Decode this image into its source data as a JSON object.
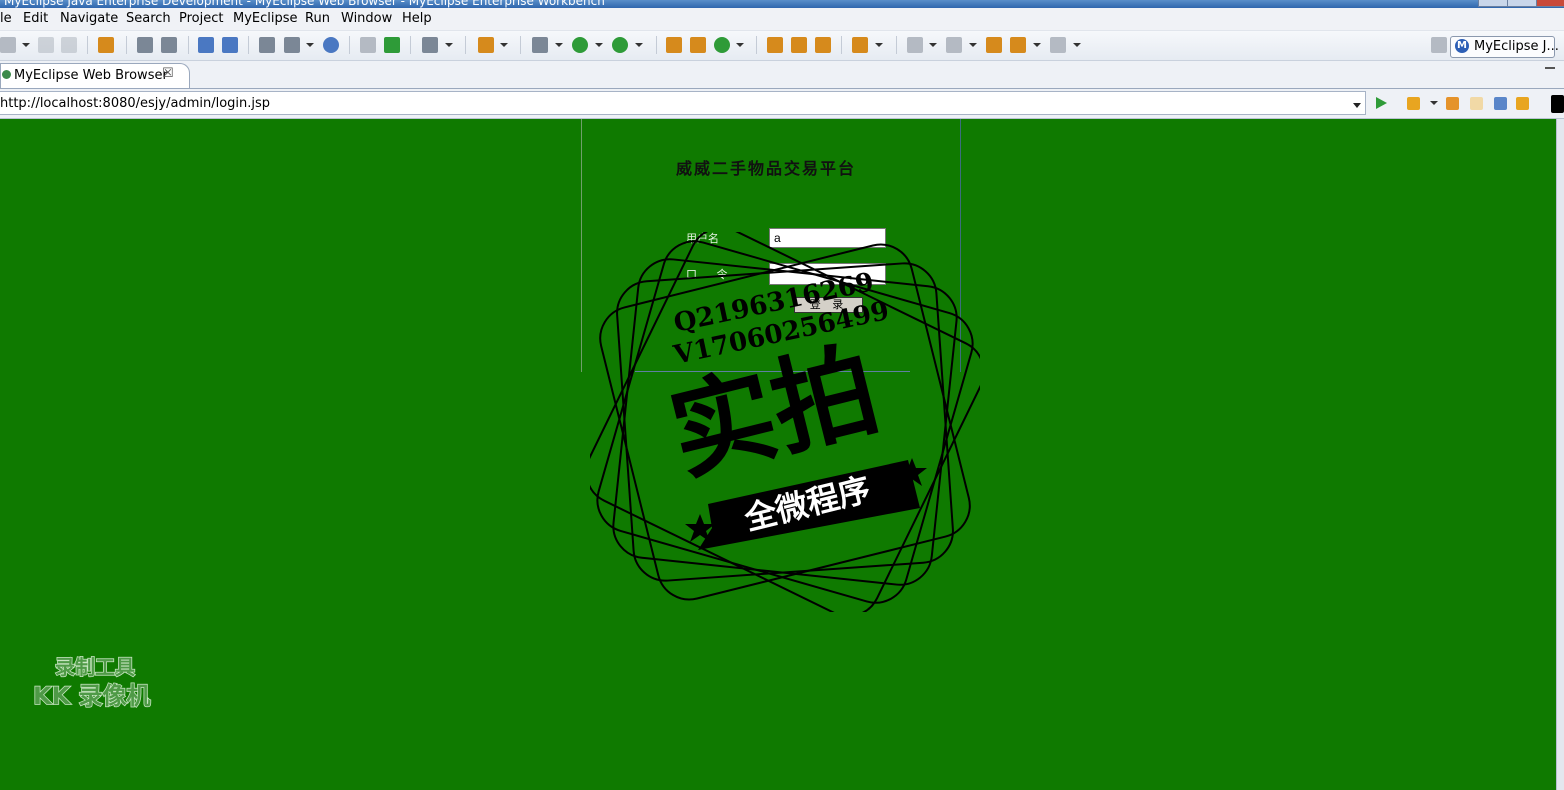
{
  "window": {
    "title": "MyEclipse Java Enterprise Development - MyEclipse Web Browser - MyEclipse Enterprise Workbench"
  },
  "menu": [
    "le",
    "Edit",
    "Navigate",
    "Search",
    "Project",
    "MyEclipse",
    "Run",
    "Window",
    "Help"
  ],
  "perspective": {
    "label": "MyEclipse J..."
  },
  "editor_tab": {
    "label": "MyEclipse Web Browser",
    "close": "☒"
  },
  "browser": {
    "url": "http://localhost:8080/esjy/admin/login.jsp"
  },
  "page": {
    "title": "威威二手物品交易平台",
    "username_label": "用户名",
    "password_label": "口 令",
    "username_value": "a",
    "password_value": "",
    "login_button": "登 录"
  },
  "watermark": {
    "qq": "Q2196316269",
    "wechat": "V17060256499",
    "big_text": "实拍",
    "ribbon_text": "全微程序"
  },
  "recorder": {
    "line1": "录制工具",
    "line2": "KK 录像机"
  },
  "colors": {
    "page_background": "#0f7a00",
    "chrome_background": "#eef1f6"
  }
}
